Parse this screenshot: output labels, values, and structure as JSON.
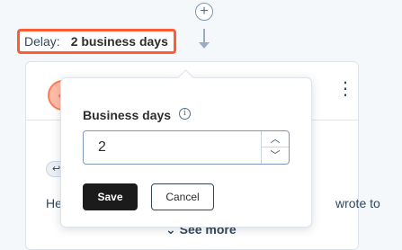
{
  "connector": {
    "add_icon": "plus-circle-icon",
    "add_glyph": "+",
    "arrow_icon": "arrow-down-icon"
  },
  "delay": {
    "label": "Delay:",
    "value": "2 business days",
    "highlight_color": "#ff5c35"
  },
  "card": {
    "icon_glyph": "↩",
    "menu_glyph": "⋮",
    "tag_glyph": "↩",
    "text_left": "He",
    "text_right": "wrote to",
    "see_more_label": "See more",
    "see_more_chevron": "⌄"
  },
  "popover": {
    "field_label": "Business days",
    "info_glyph": "i",
    "input_value": "2",
    "step_up_glyph": "︿",
    "step_down_glyph": "﹀",
    "save_label": "Save",
    "cancel_label": "Cancel",
    "primary_color": "#1b1b1b"
  }
}
